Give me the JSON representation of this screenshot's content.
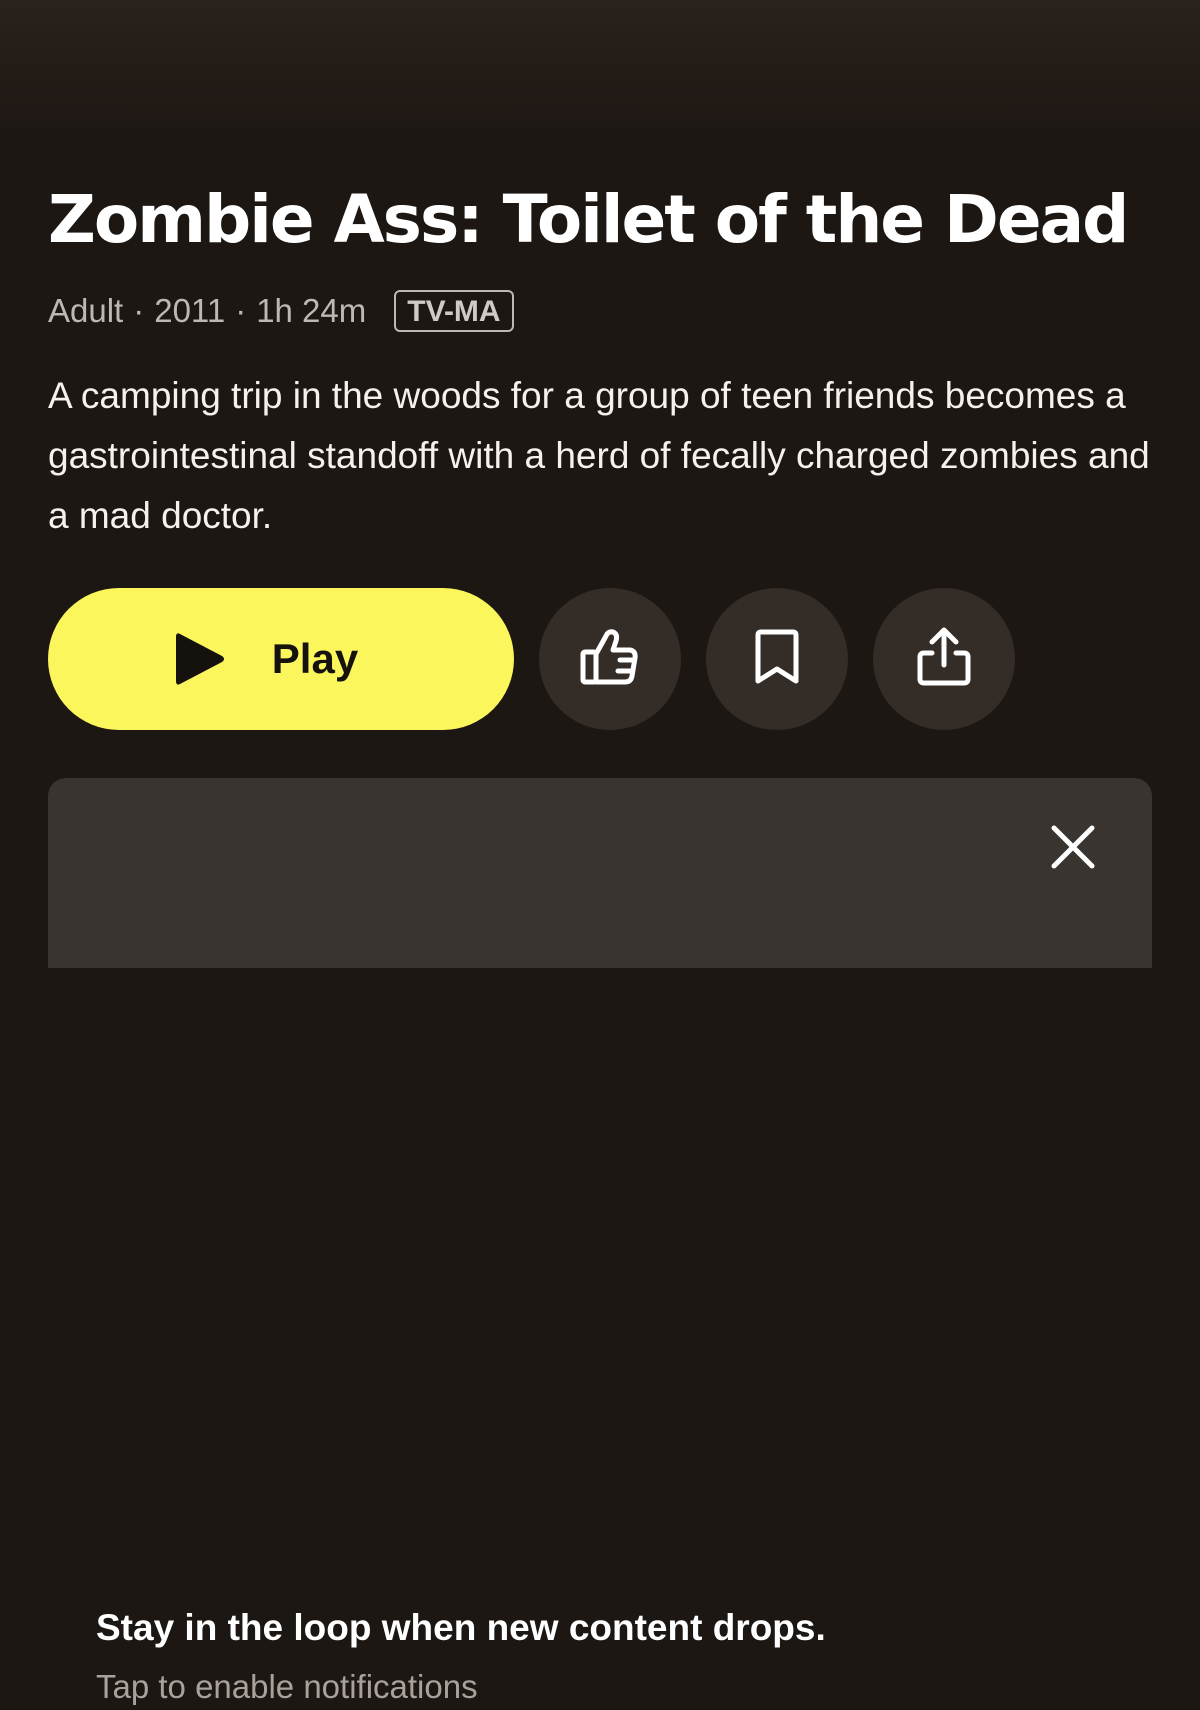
{
  "show": {
    "title": "Zombie Ass: Toilet of the Dead",
    "genre": "Adult",
    "year": "2011",
    "duration": "1h 24m",
    "separator": "·",
    "rating": "TV-MA",
    "description": "A camping trip in the woods for a group of teen friends becomes a gastrointestinal standoff with a herd of fecally charged zombies and a mad doctor."
  },
  "actions": {
    "play_label": "Play",
    "like_icon": "thumbs-up-icon",
    "save_icon": "bookmark-icon",
    "share_icon": "share-icon"
  },
  "notification": {
    "title": "Stay in the loop when new content drops.",
    "subtitle": "Tap to enable notifications",
    "close_icon": "close-icon"
  },
  "colors": {
    "background": "#1d1713",
    "accent": "#fbf65b",
    "button_dark": "#342c27",
    "card": "#3a3430"
  }
}
